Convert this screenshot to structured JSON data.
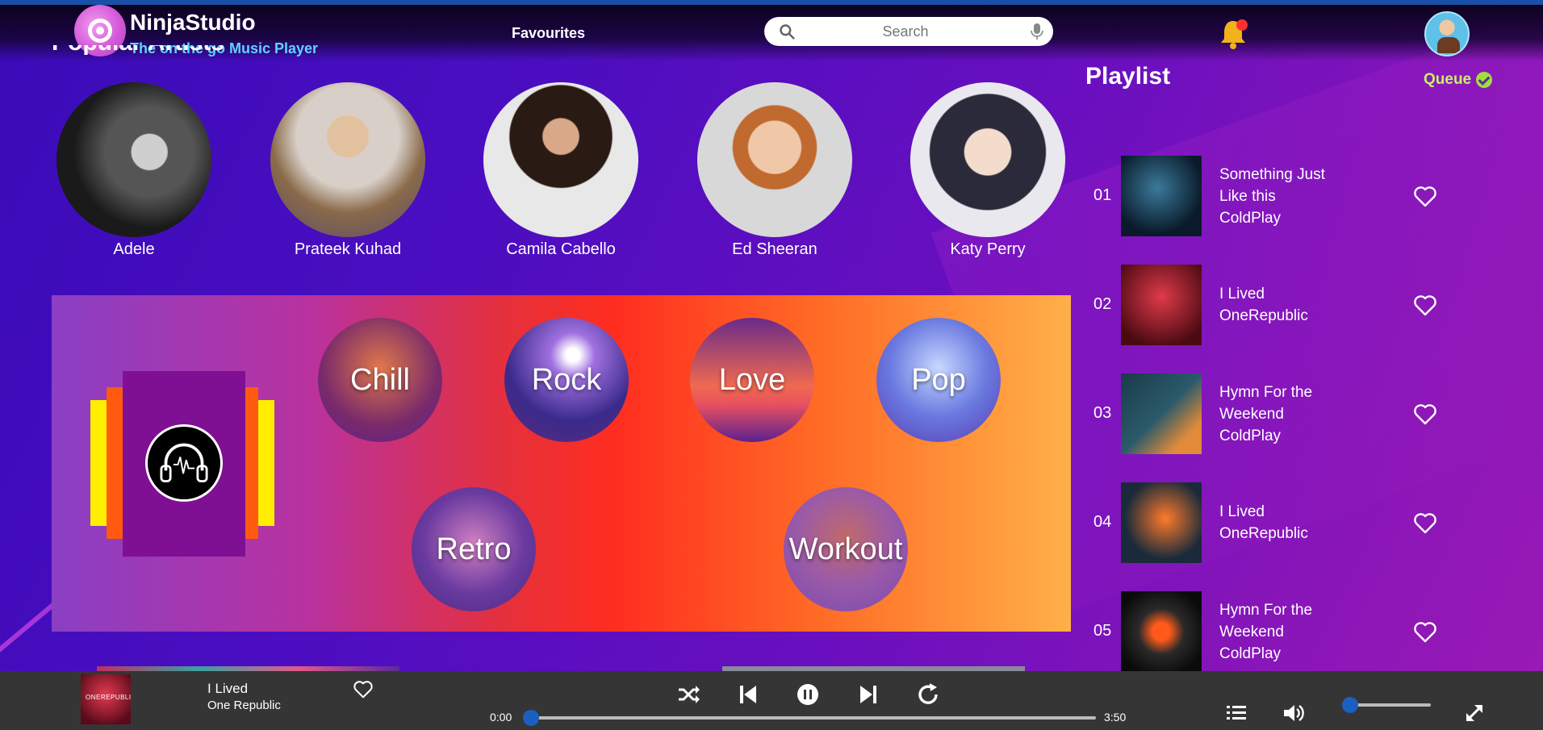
{
  "brand": {
    "name": "NinjaStudio",
    "tagline": "The on the go Music Player"
  },
  "nav": {
    "favourites": "Favourites"
  },
  "search": {
    "placeholder": "Search"
  },
  "colors": {
    "accent_blue": "#1b5fc0",
    "tagline": "#5fd3ff",
    "queue": "#c8f06a",
    "notification_dot": "#ff3030",
    "player_bar": "#353535"
  },
  "artists": {
    "title": "Popular Artists",
    "items": [
      {
        "name": "Adele"
      },
      {
        "name": "Prateek Kuhad"
      },
      {
        "name": "Camila Cabello"
      },
      {
        "name": "Ed Sheeran"
      },
      {
        "name": "Katy Perry"
      }
    ]
  },
  "genres": {
    "items": [
      {
        "label": "Chill"
      },
      {
        "label": "Rock"
      },
      {
        "label": "Love"
      },
      {
        "label": "Pop"
      },
      {
        "label": "Retro"
      },
      {
        "label": "Workout"
      }
    ]
  },
  "playlist": {
    "title": "Playlist",
    "queue_label": "Queue",
    "items": [
      {
        "num": "01",
        "title_line1": "Something Just",
        "title_line2": "Like this",
        "artist": "ColdPlay"
      },
      {
        "num": "02",
        "title_line1": "I Lived",
        "title_line2": "",
        "artist": "OneRepublic"
      },
      {
        "num": "03",
        "title_line1": "Hymn For the",
        "title_line2": "Weekend",
        "artist": "ColdPlay"
      },
      {
        "num": "04",
        "title_line1": "I Lived",
        "title_line2": "",
        "artist": "OneRepublic"
      },
      {
        "num": "05",
        "title_line1": "Hymn For the",
        "title_line2": "Weekend",
        "artist": "ColdPlay"
      }
    ]
  },
  "player": {
    "track_title": "I Lived",
    "track_artist": "One Republic",
    "thumb_text": "ONEREPUBLIC",
    "time_current": "0:00",
    "time_total": "3:50",
    "progress": 0.0,
    "volume": 0.0
  }
}
